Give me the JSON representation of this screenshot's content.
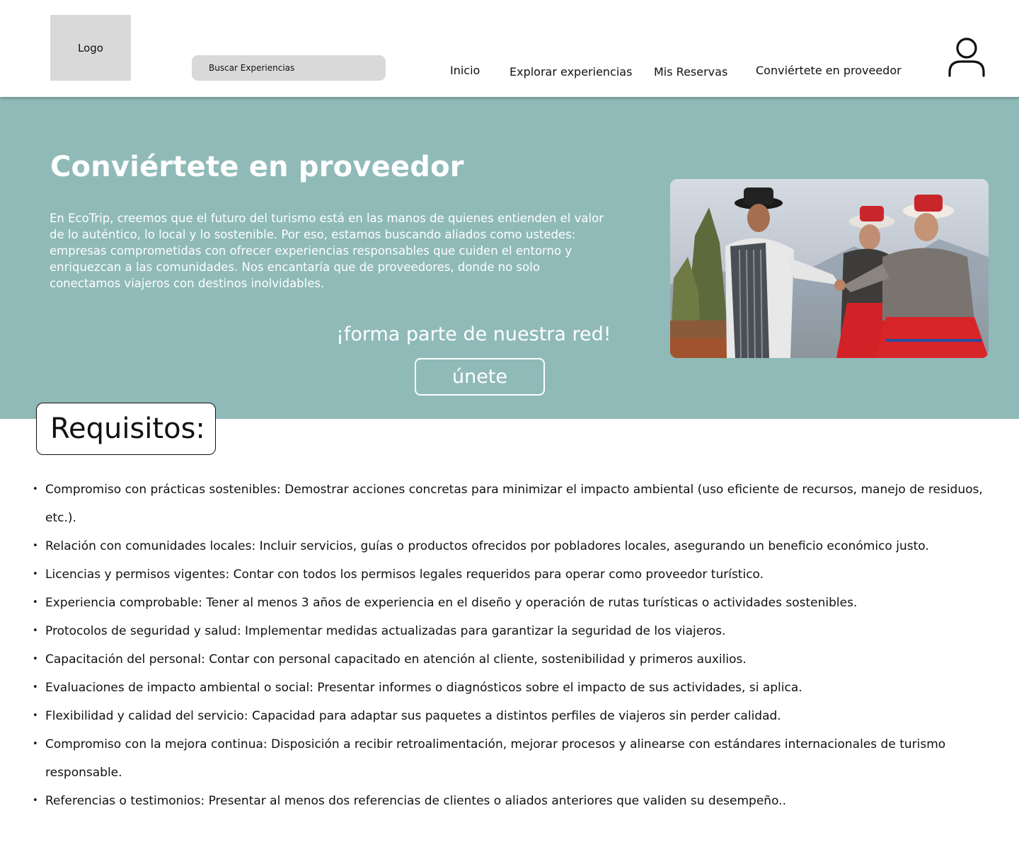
{
  "header": {
    "logo_label": "Logo",
    "search_placeholder": "Buscar Experiencias",
    "nav": {
      "inicio": "Inicio",
      "explorar": "Explorar experiencias",
      "reservas": "Mis Reservas",
      "proveedor": "Conviértete en proveedor"
    },
    "user_icon": "user-icon"
  },
  "hero": {
    "background_color": "#8fbab8",
    "title": "Conviértete en proveedor",
    "paragraph": "En EcoTrip, creemos que el futuro del turismo está en las manos de quienes entienden el valor de lo auténtico, lo local y lo sostenible. Por eso, estamos buscando aliados como ustedes: empresas comprometidas con ofrecer experiencias responsables que cuiden el entorno y enriquezcan a las comunidades. Nos encantaría que  de proveedores, donde no solo conectamos viajeros con destinos inolvidables.",
    "cta_text": "¡forma parte de nuestra red!",
    "join_button": "únete"
  },
  "requirements": {
    "heading": "Requisitos:",
    "items": [
      "Compromiso con prácticas sostenibles: Demostrar acciones concretas para minimizar el impacto ambiental (uso eficiente de recursos, manejo de residuos, etc.).",
      "Relación con comunidades locales: Incluir servicios, guías o productos ofrecidos por pobladores locales, asegurando un beneficio económico justo.",
      "Licencias y permisos vigentes: Contar con todos los permisos legales requeridos para operar como proveedor turístico.",
      "Experiencia comprobable: Tener al menos 3 años de experiencia en el diseño y operación de rutas turísticas o actividades sostenibles.",
      "Protocolos de seguridad y salud: Implementar medidas actualizadas para garantizar la seguridad de los viajeros.",
      "Capacitación del personal: Contar con personal capacitado en atención al cliente, sostenibilidad y primeros auxilios.",
      "Evaluaciones de impacto ambiental o social: Presentar informes o diagnósticos sobre el impacto de sus actividades, si aplica.",
      "Flexibilidad y calidad del servicio: Capacidad para adaptar sus paquetes a distintos perfiles de viajeros sin perder calidad.",
      "Compromiso con la mejora continua: Disposición a recibir retroalimentación, mejorar procesos y alinearse con estándares internacionales de turismo responsable.",
      "Referencias o testimonios: Presentar al menos dos referencias de clientes o aliados anteriores que validen su desempeño.."
    ]
  }
}
